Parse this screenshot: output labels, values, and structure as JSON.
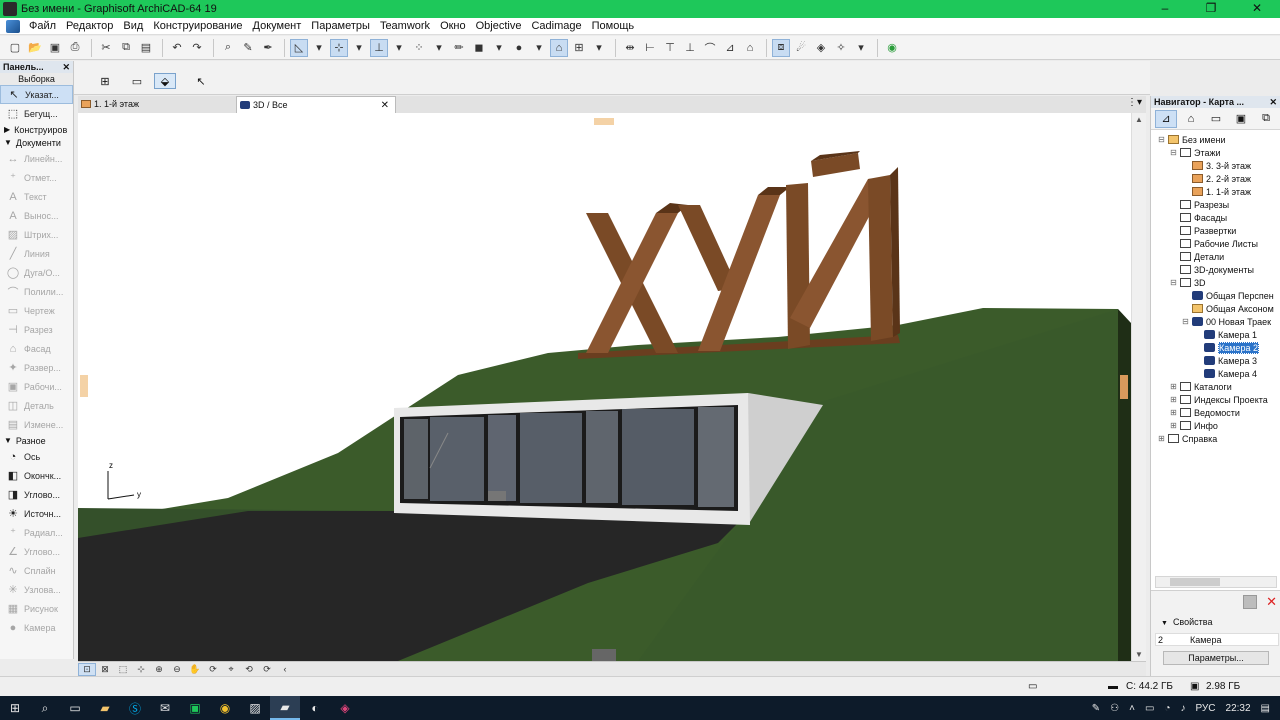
{
  "window": {
    "title": "Без имени - Graphisoft ArchiCAD-64 19",
    "controls": [
      "–",
      "❐",
      "✕"
    ]
  },
  "menu": [
    "Файл",
    "Редактор",
    "Вид",
    "Конструирование",
    "Документ",
    "Параметры",
    "Teamwork",
    "Окно",
    "Objective",
    "Cadimage",
    "Помощь"
  ],
  "toolbox": {
    "title": "Панель...",
    "subtitle": "Выборка",
    "tools_top": [
      {
        "label": "Указат...",
        "icon": "↖"
      },
      {
        "label": "Бегущ...",
        "icon": "⬚"
      }
    ],
    "sections": {
      "construct": "Конструиров",
      "document": "Документи",
      "misc": "Разное"
    },
    "doc_tools": [
      {
        "label": "Линейн...",
        "icon": "↔"
      },
      {
        "label": "Отмет...",
        "icon": "⁺"
      },
      {
        "label": "Текст",
        "icon": "A"
      },
      {
        "label": "Вынос...",
        "icon": "A"
      },
      {
        "label": "Штрих...",
        "icon": "▨"
      },
      {
        "label": "Линия",
        "icon": "╱"
      },
      {
        "label": "Дуга/О...",
        "icon": "◯"
      },
      {
        "label": "Полили...",
        "icon": "⌒"
      },
      {
        "label": "Чертеж",
        "icon": "▭"
      },
      {
        "label": "Разрез",
        "icon": "⊣"
      },
      {
        "label": "Фасад",
        "icon": "⌂"
      },
      {
        "label": "Развер...",
        "icon": "✦"
      },
      {
        "label": "Рабочи...",
        "icon": "▣"
      },
      {
        "label": "Деталь",
        "icon": "◫"
      },
      {
        "label": "Измене...",
        "icon": "▤"
      }
    ],
    "misc_tools": [
      {
        "label": "Ось",
        "icon": "◔",
        "dim": false
      },
      {
        "label": "Окончк...",
        "icon": "◧",
        "dim": false
      },
      {
        "label": "Углово...",
        "icon": "◨",
        "dim": false
      },
      {
        "label": "Источн...",
        "icon": "☀",
        "dim": false
      },
      {
        "label": "Радиал...",
        "icon": "⁺",
        "dim": true
      },
      {
        "label": "Углово...",
        "icon": "∠",
        "dim": true
      },
      {
        "label": "Сплайн",
        "icon": "∿",
        "dim": true
      },
      {
        "label": "Узлова...",
        "icon": "✳",
        "dim": true
      },
      {
        "label": "Рисунок",
        "icon": "▦",
        "dim": true
      },
      {
        "label": "Камера",
        "icon": "●",
        "dim": true
      }
    ]
  },
  "tabs": [
    {
      "label": "1. 1-й этаж"
    },
    {
      "label": "3D / Все"
    }
  ],
  "viewport": {
    "sign_text": "ХУЙ",
    "axis_z": "z",
    "axis_y": "y",
    "colors": {
      "grass": "#3b5b2a",
      "grass_dark": "#2c4a1f",
      "road": "#262626",
      "wood": "#7a4a26",
      "wood_dark": "#5a3418",
      "concrete": "#e8e8e8",
      "glass": "#5a6066"
    }
  },
  "navigator": {
    "title": "Навигатор - Карта ...",
    "tree": [
      {
        "label": "Без имени",
        "level": 0,
        "icon": "folder",
        "exp": "⊟"
      },
      {
        "label": "Этажи",
        "level": 1,
        "icon": "plain",
        "exp": "⊟"
      },
      {
        "label": "3. 3-й этаж",
        "level": 2,
        "icon": "story",
        "exp": ""
      },
      {
        "label": "2. 2-й этаж",
        "level": 2,
        "icon": "story",
        "exp": ""
      },
      {
        "label": "1. 1-й этаж",
        "level": 2,
        "icon": "story",
        "exp": ""
      },
      {
        "label": "Разрезы",
        "level": 1,
        "icon": "plain",
        "exp": ""
      },
      {
        "label": "Фасады",
        "level": 1,
        "icon": "plain",
        "exp": ""
      },
      {
        "label": "Развертки",
        "level": 1,
        "icon": "plain",
        "exp": ""
      },
      {
        "label": "Рабочие Листы",
        "level": 1,
        "icon": "plain",
        "exp": ""
      },
      {
        "label": "Детали",
        "level": 1,
        "icon": "plain",
        "exp": ""
      },
      {
        "label": "3D-документы",
        "level": 1,
        "icon": "plain",
        "exp": ""
      },
      {
        "label": "3D",
        "level": 1,
        "icon": "plain",
        "exp": "⊟"
      },
      {
        "label": "Общая Перспен",
        "level": 2,
        "icon": "cam",
        "exp": ""
      },
      {
        "label": "Общая Аксоном",
        "level": 2,
        "icon": "folder",
        "exp": ""
      },
      {
        "label": "00 Новая Траек",
        "level": 2,
        "icon": "cam",
        "exp": "⊟"
      },
      {
        "label": "Камера 1",
        "level": 3,
        "icon": "cam",
        "exp": ""
      },
      {
        "label": "Камера 2",
        "level": 3,
        "icon": "cam",
        "exp": "",
        "selected": true
      },
      {
        "label": "Камера 3",
        "level": 3,
        "icon": "cam",
        "exp": ""
      },
      {
        "label": "Камера 4",
        "level": 3,
        "icon": "cam",
        "exp": ""
      },
      {
        "label": "Каталоги",
        "level": 1,
        "icon": "plain",
        "exp": "⊞"
      },
      {
        "label": "Индексы Проекта",
        "level": 1,
        "icon": "plain",
        "exp": "⊞"
      },
      {
        "label": "Ведомости",
        "level": 1,
        "icon": "plain",
        "exp": "⊞"
      },
      {
        "label": "Инфо",
        "level": 1,
        "icon": "plain",
        "exp": "⊞"
      },
      {
        "label": "Справка",
        "level": 0,
        "icon": "plain",
        "exp": "⊞"
      }
    ],
    "props": {
      "title": "Свойства",
      "row_id": "2",
      "row_value": "Камера",
      "button": "Параметры..."
    }
  },
  "status": {
    "disk": "С: 44.2 ГБ",
    "memory": "2.98 ГБ"
  },
  "tray": {
    "lang": "РУС",
    "time": "22:32"
  }
}
